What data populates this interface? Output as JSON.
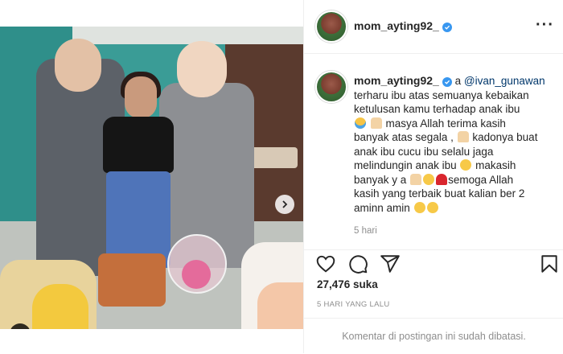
{
  "post": {
    "username": "mom_ayting92_",
    "verified": true,
    "more_icon": "more-horizontal-icon",
    "caption": {
      "mention": "@ivan_gunawan",
      "prefix": "a",
      "lines": [
        "terharu ibu atas semuanya kebaikan",
        "ketulusan kamu terhadap anak ibu",
        "masya Allah terima kasih",
        "banyak atas segala ,",
        "kadonya buat",
        "anak ibu cucu ibu selalu jaga",
        "melindungin anak ibu",
        "makasih",
        "banyak y a",
        "semoga Allah",
        "kasih yang terbaik buat kalian ber 2",
        "aminn amin"
      ]
    },
    "time_ago": "5 hari",
    "likes": "27,476 suka",
    "posted_ago": "5 HARI YANG LALU",
    "comments_status": "Komentar di postingan ini sudah dibatasi.",
    "carousel": {
      "slides": 3,
      "active_index": 0
    },
    "icons": {
      "like": "heart-icon",
      "comment": "comment-icon",
      "share": "send-icon",
      "save": "bookmark-icon",
      "next": "chevron-right-icon",
      "user_tag": "user-tag-icon"
    },
    "colors": {
      "verified": "#3897f0",
      "mention": "#00376b",
      "carousel_active": "#2a8ff7"
    }
  }
}
